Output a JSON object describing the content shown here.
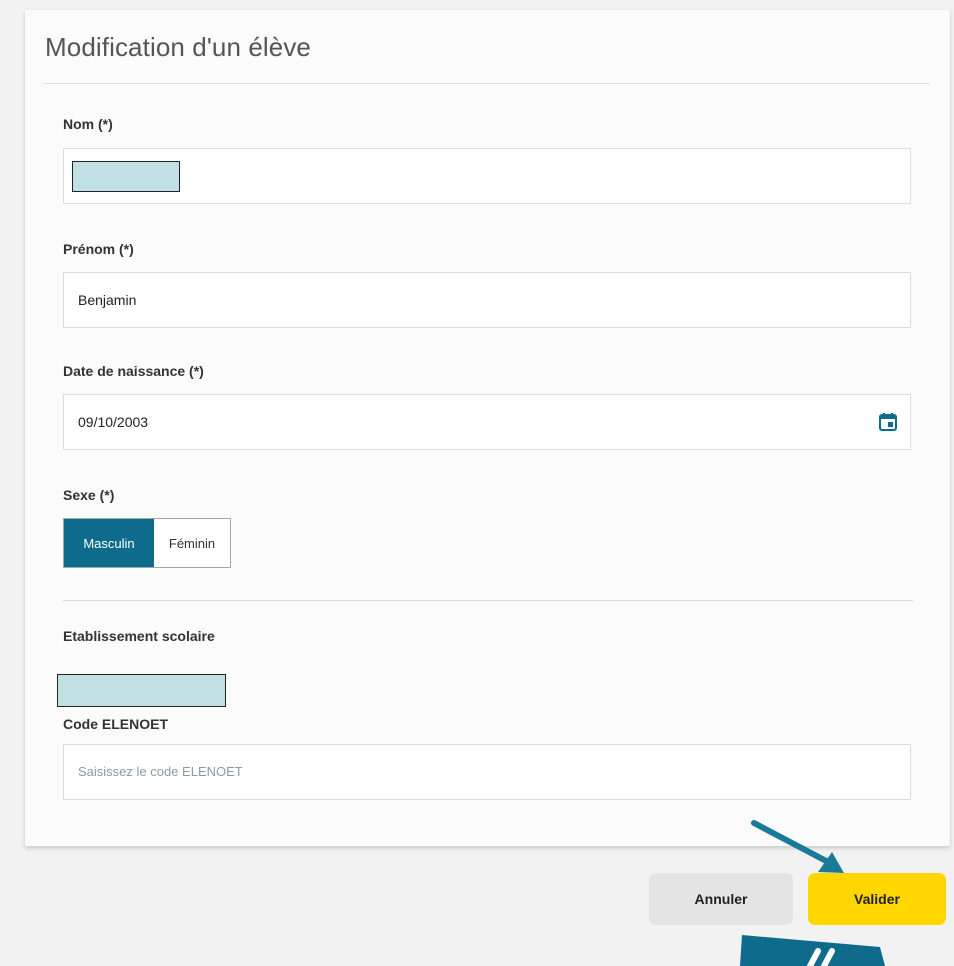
{
  "modal": {
    "title": "Modification d'un élève"
  },
  "fields": {
    "nom": {
      "label": "Nom (*)",
      "value": ""
    },
    "prenom": {
      "label": "Prénom (*)",
      "value": "Benjamin"
    },
    "date_naissance": {
      "label": "Date de naissance (*)",
      "value": "09/10/2003",
      "icon": "calendar-icon"
    },
    "sexe": {
      "label": "Sexe (*)",
      "options": [
        "Masculin",
        "Féminin"
      ],
      "selected": "Masculin"
    },
    "etablissement": {
      "label": "Etablissement scolaire",
      "value": ""
    },
    "code_elenoet": {
      "label": "Code ELENOET",
      "placeholder": "Saisissez le code ELENOET",
      "value": ""
    }
  },
  "buttons": {
    "cancel": "Annuler",
    "ok": "Valider"
  },
  "colors": {
    "accent": "#0e6b8c",
    "ok_button": "#ffd600",
    "cancel_button": "#e4e4e4",
    "redaction": "#c0e0e3",
    "annotation_arrow": "#1a7a9a"
  }
}
